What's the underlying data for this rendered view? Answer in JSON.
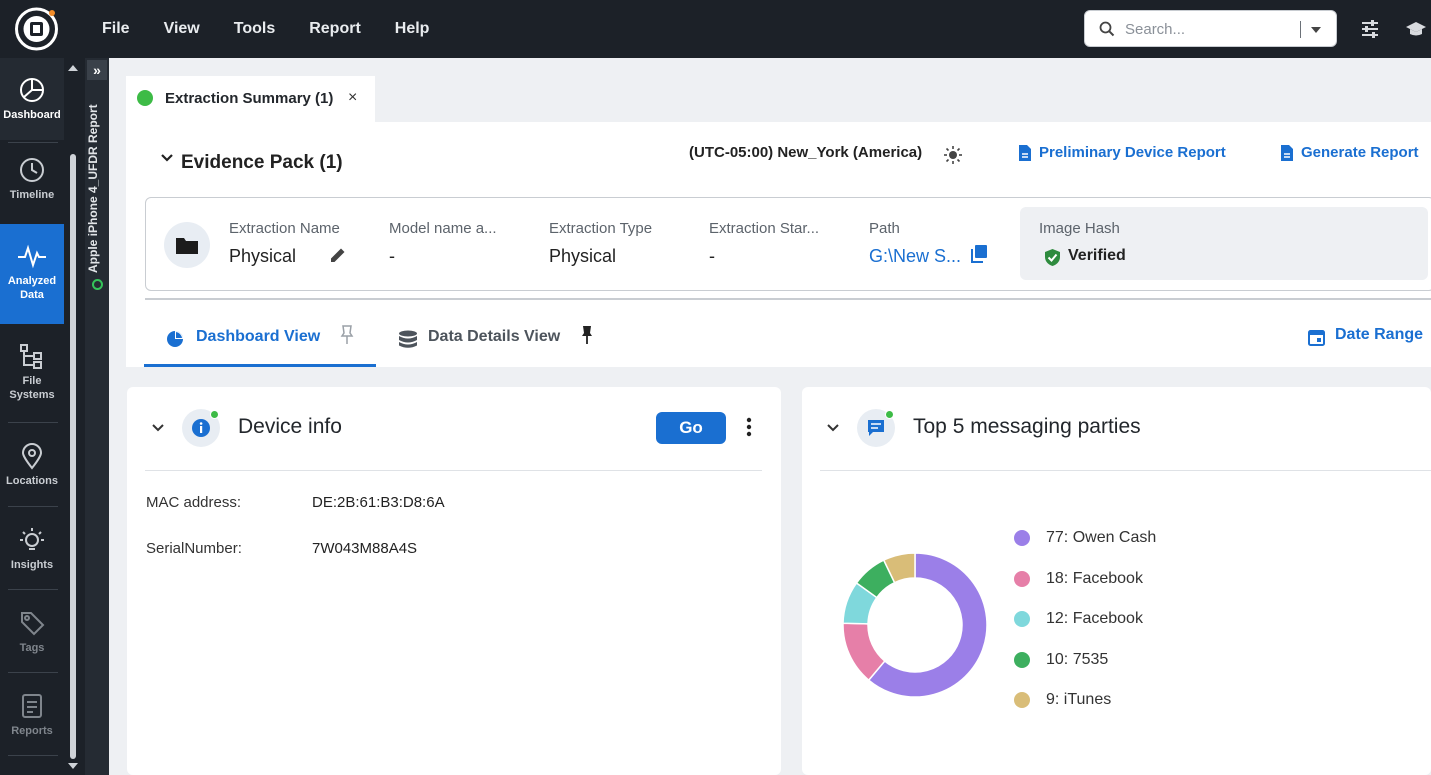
{
  "menu": {
    "file": "File",
    "view": "View",
    "tools": "Tools",
    "report": "Report",
    "help": "Help"
  },
  "search": {
    "placeholder": "Search..."
  },
  "leftnav": {
    "dashboard": "Dashboard",
    "timeline": "Timeline",
    "analyzed_line1": "Analyzed",
    "analyzed_line2": "Data",
    "file_line1": "File",
    "file_line2": "Systems",
    "locations": "Locations",
    "insights": "Insights",
    "tags": "Tags",
    "reports": "Reports"
  },
  "vertical_strip": {
    "report_name": "Apple iPhone 4_UFDR Report"
  },
  "tab": {
    "label": "Extraction Summary (1)",
    "close": "×"
  },
  "evidence": {
    "title": "Evidence Pack (1)",
    "timezone": "(UTC-05:00) New_York (America)",
    "preliminary": "Preliminary Device Report",
    "generate": "Generate Report"
  },
  "extraction": {
    "name_label": "Extraction Name",
    "name_value": "Physical",
    "model_label": "Model name a...",
    "model_value": "-",
    "type_label": "Extraction Type",
    "type_value": "Physical",
    "start_label": "Extraction Star...",
    "start_value": "-",
    "path_label": "Path",
    "path_value": "G:\\New S...",
    "hash_label": "Image Hash",
    "hash_value": "Verified"
  },
  "views": {
    "dashboard": "Dashboard View",
    "details": "Data Details View",
    "date_range": "Date Range"
  },
  "device_info": {
    "title": "Device info",
    "go": "Go",
    "mac_label": "MAC address:",
    "mac_value": "DE:2B:61:B3:D8:6A",
    "serial_label": "SerialNumber:",
    "serial_value": "7W043M88A4S"
  },
  "messaging": {
    "title": "Top 5 messaging parties",
    "legend": [
      "77: Owen Cash",
      "18: Facebook",
      "12: Facebook",
      "10: 7535",
      "9: iTunes"
    ]
  },
  "chart_data": {
    "type": "pie",
    "categories": [
      "Owen Cash",
      "Facebook",
      "Facebook",
      "7535",
      "iTunes"
    ],
    "values": [
      77,
      18,
      12,
      10,
      9
    ],
    "colors": [
      "#9b7fe8",
      "#e67fa8",
      "#7fd8dc",
      "#3daf5f",
      "#d9bd78"
    ],
    "title": "Top 5 messaging parties",
    "legend_position": "right"
  }
}
